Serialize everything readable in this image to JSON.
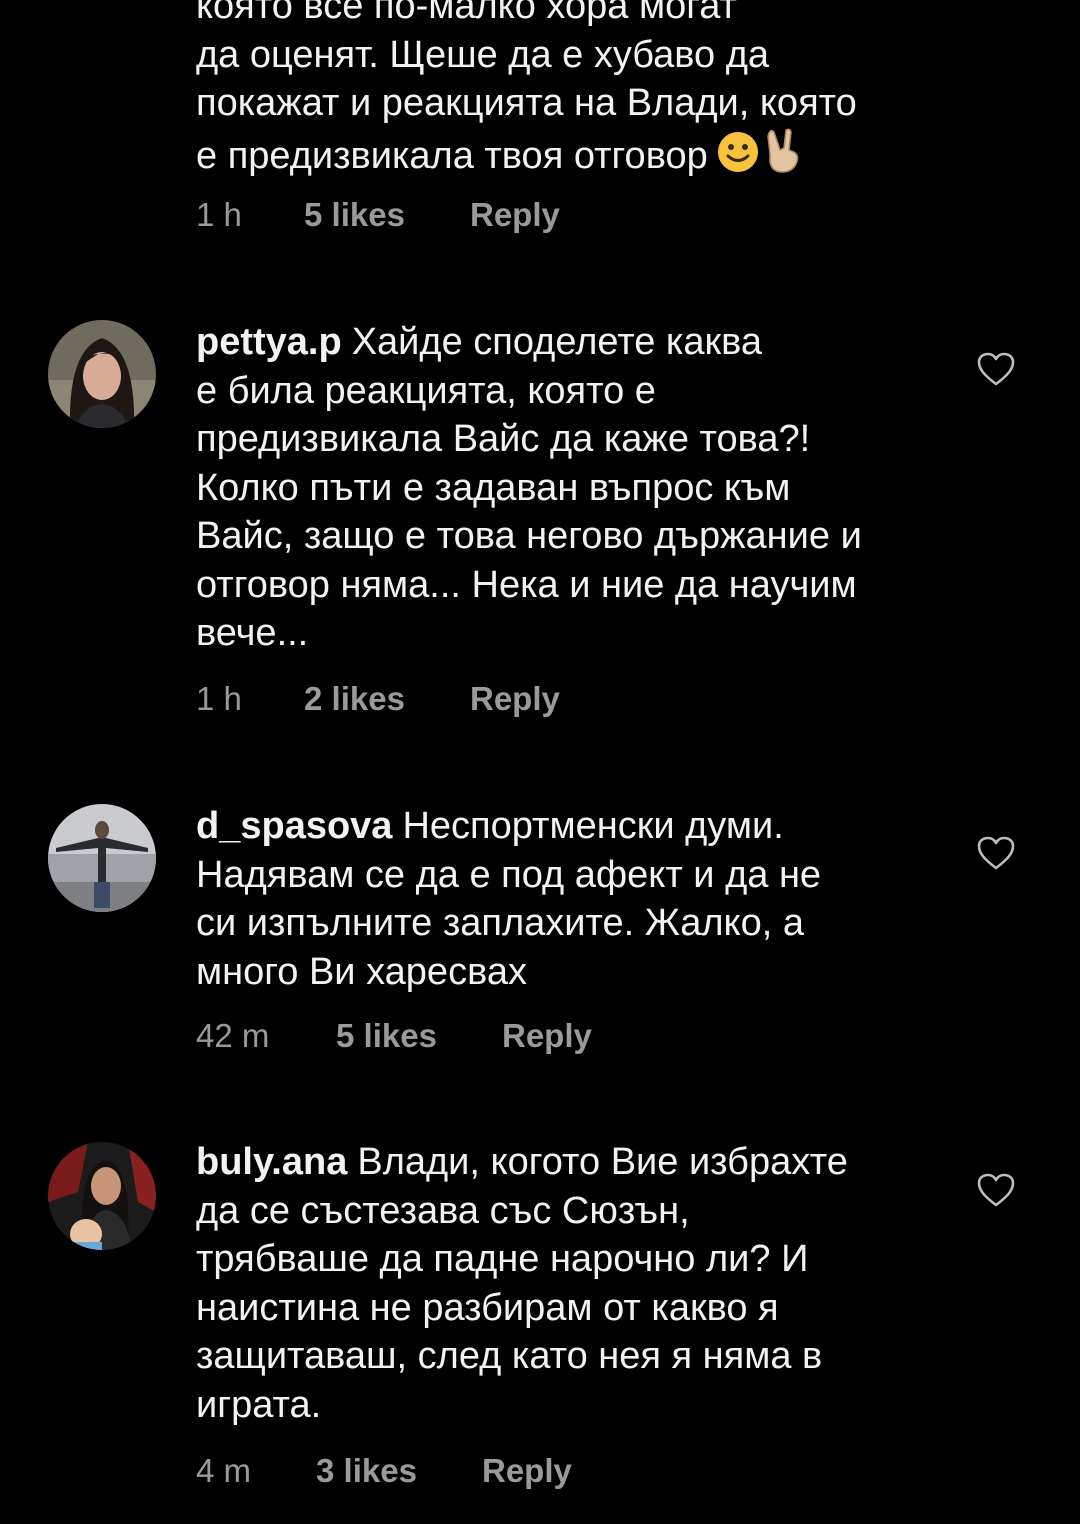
{
  "comments": [
    {
      "username": "",
      "lines": [
        "която все по-малко хора могат",
        "да оценят. Щеше да е хубаво да",
        "покажат и реакцията на Влади, която",
        "е предизвикала твоя отговор"
      ],
      "emojis": [
        "slightly-smiling-face",
        "victory-hand"
      ],
      "time": "1 h",
      "likes": "5 likes",
      "reply": "Reply"
    },
    {
      "username": "pettya.p",
      "lines": [
        "Хайде споделете каква",
        "е била реакцията, която е",
        "предизвикала Вайс да каже това?!",
        "Колко пъти е задаван въпрос към",
        "Вайс, защо е това негово държание и",
        "отговор няма... Нека и ние да научим",
        "вече..."
      ],
      "time": "1 h",
      "likes": "2 likes",
      "reply": "Reply"
    },
    {
      "username": "d_spasova",
      "lines": [
        "Неспортменски думи.",
        "Надявам се да е под афект и да не",
        "си изпълните заплахите. Жалко, а",
        "много Ви харесвах"
      ],
      "time": "42 m",
      "likes": "5 likes",
      "reply": "Reply"
    },
    {
      "username": "buly.ana",
      "lines": [
        "Влади, когото Вие избрахте",
        "да се състезава със Сюзън,",
        "трябваше да падне нарочно ли? И",
        "наистина не разбирам от какво я",
        "защитаваш, след като нея я няма в",
        "играта."
      ],
      "time": "4 m",
      "likes": "3 likes",
      "reply": "Reply"
    }
  ],
  "icons": {
    "like": "heart-outline-icon"
  },
  "colors": {
    "background": "#000000",
    "text": "#f2f2f2",
    "meta": "#9a9a9a"
  }
}
